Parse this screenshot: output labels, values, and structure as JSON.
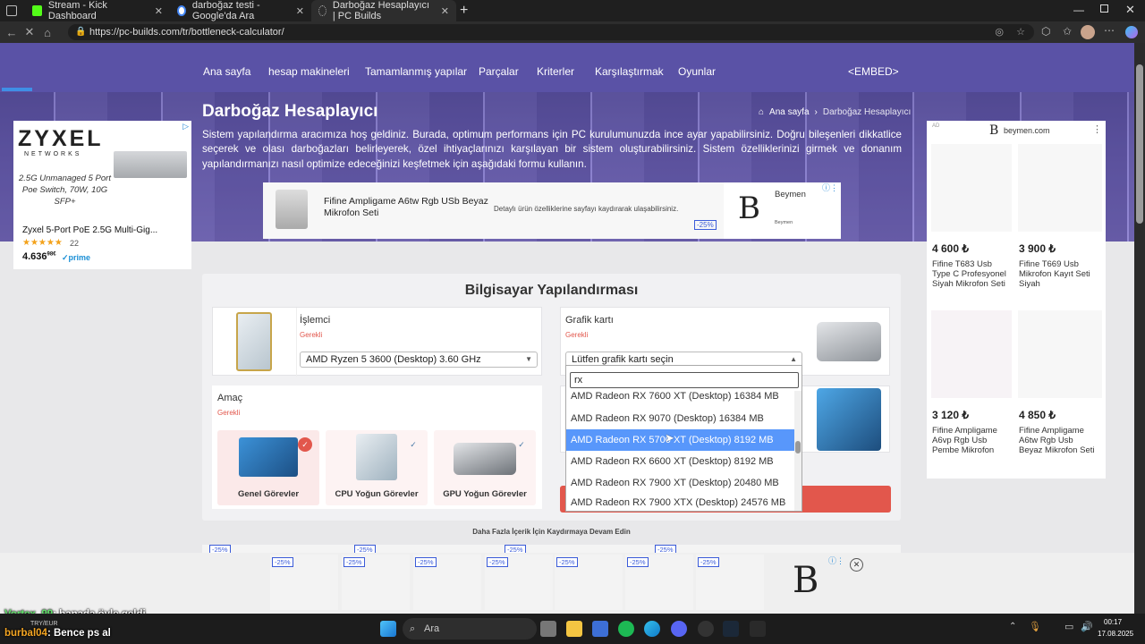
{
  "browser": {
    "tabs": [
      {
        "label": "Stream - Kick Dashboard",
        "icon": "kick-icon"
      },
      {
        "label": "darboğaz testi - Google'da Ara",
        "icon": "google-icon"
      },
      {
        "label": "Darboğaz Hesaplayıcı | PC Builds",
        "icon": "loading-icon"
      }
    ],
    "url": "https://pc-builds.com/tr/bottleneck-calculator/"
  },
  "nav": {
    "links": [
      "Ana sayfa",
      "hesap makineleri",
      "Tamamlanmış yapılar",
      "Parçalar",
      "Kriterler",
      "Karşılaştırmak",
      "Oyunlar",
      "<EMBED>"
    ]
  },
  "hero": {
    "title": "Darboğaz Hesaplayıcı",
    "breadcrumb_home": "Ana sayfa",
    "breadcrumb_current": "Darboğaz Hesaplayıcı",
    "intro": "Sistem yapılandırma aracımıza hoş geldiniz. Burada, optimum performans için PC kurulumunuzda ince ayar yapabilirsiniz. Doğru bileşenleri dikkatlice seçerek ve olası darboğazları belirleyerek, özel ihtiyaçlarınızı karşılayan bir sistem oluşturabilirsiniz. Sistem özelliklerinizi girmek ve donanım yapılandırmanızı nasıl optimize edeceğinizi keşfetmek için aşağıdaki formu kullanın."
  },
  "ad_left": {
    "brand": "ZYXEL",
    "brand_sub": "NETWORKS",
    "tagline": "2.5G Unmanaged 5 Port Poe Switch, 70W, 10G SFP+",
    "product": "Zyxel 5-Port PoE 2.5G Multi-Gig...",
    "reviews": "22",
    "price": "4.636",
    "price_sup": "98€",
    "prime": "✓prime"
  },
  "ad_center": {
    "product": "Fifine Ampligame A6tw Rgb USb Beyaz Mikrofon Seti",
    "desc": "Detaylı ürün özelliklerine sayfayı kaydırarak ulaşabilirsiniz.",
    "badge": "-25%",
    "brand": "Beymen",
    "brand_sub": "Beymen",
    "logo": "B"
  },
  "ad_right": {
    "label": "AD",
    "site": "beymen.com",
    "logo": "B",
    "items": [
      {
        "price": "4 600 ₺",
        "name": "Fifine T683 Usb Type C Profesyonel Siyah Mikrofon Seti"
      },
      {
        "price": "3 900 ₺",
        "name": "Fifine T669 Usb Mikrofon Kayıt Seti Siyah"
      },
      {
        "price": "3 120 ₺",
        "name": "Fifine Ampligame A6vp Rgb Usb Pembe Mikrofon"
      },
      {
        "price": "4 850 ₺",
        "name": "Fifine Ampligame A6tw Rgb Usb Beyaz Mikrofon Seti"
      }
    ]
  },
  "config": {
    "title": "Bilgisayar Yapılandırması",
    "cpu_label": "İşlemci",
    "cpu_required": "Gerekli",
    "cpu_value": "AMD Ryzen 5 3600 (Desktop) 3.60 GHz",
    "gpu_label": "Grafik kartı",
    "gpu_required": "Gerekli",
    "gpu_placeholder": "Lütfen grafik kartı seçin",
    "purpose_label": "Amaç",
    "purpose_required": "Gerekli",
    "purposes": [
      "Genel Görevler",
      "CPU Yoğun Görevler",
      "GPU Yoğun Görevler"
    ],
    "dropdown": {
      "search_value": "rx",
      "options": [
        "AMD Radeon RX 7600 XT (Desktop) 16384 MB",
        "AMD Radeon RX 9070 (Desktop) 16384 MB",
        "AMD Radeon RX 5700 XT (Desktop) 8192 MB",
        "AMD Radeon RX 6600 XT (Desktop) 8192 MB",
        "AMD Radeon RX 7900 XT (Desktop) 20480 MB",
        "AMD Radeon RX 7900 XTX (Desktop) 24576 MB"
      ],
      "highlighted_index": 2
    }
  },
  "more_text": "Daha Fazla İçerik İçin Kaydırmaya Devam Edin",
  "bottom_ad": {
    "badges": [
      "-25%",
      "-25%",
      "-25%",
      "-25%",
      "-25%",
      "-25%",
      "-25%"
    ],
    "logo": "B",
    "top_badges": [
      "-25%",
      "-25%",
      "-25%",
      "-25%"
    ]
  },
  "chat": [
    {
      "user": "Vortex_99",
      "text": ": banada öyle geldi",
      "user_color": "#62e36b"
    },
    {
      "user": "burbal04",
      "text": ": Bence ps al",
      "user_color": "#f5a623"
    }
  ],
  "taskbar": {
    "search_placeholder": "Ara",
    "weather": "TRY/EUR",
    "time": "00:17",
    "date": "17.08.2025"
  }
}
